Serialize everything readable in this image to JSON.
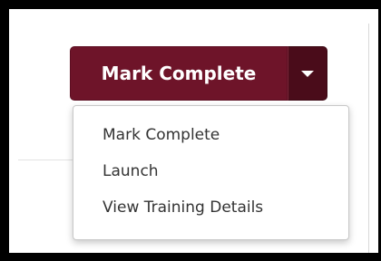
{
  "actions": {
    "primary_label": "Mark Complete",
    "toggle_icon": "caret-down-icon"
  },
  "dropdown": {
    "items": [
      {
        "label": "Mark Complete"
      },
      {
        "label": "Launch"
      },
      {
        "label": "View Training Details"
      }
    ]
  },
  "colors": {
    "primary_button": "#6e1429",
    "toggle_button": "#4a0c1a",
    "menu_text": "#333333"
  }
}
